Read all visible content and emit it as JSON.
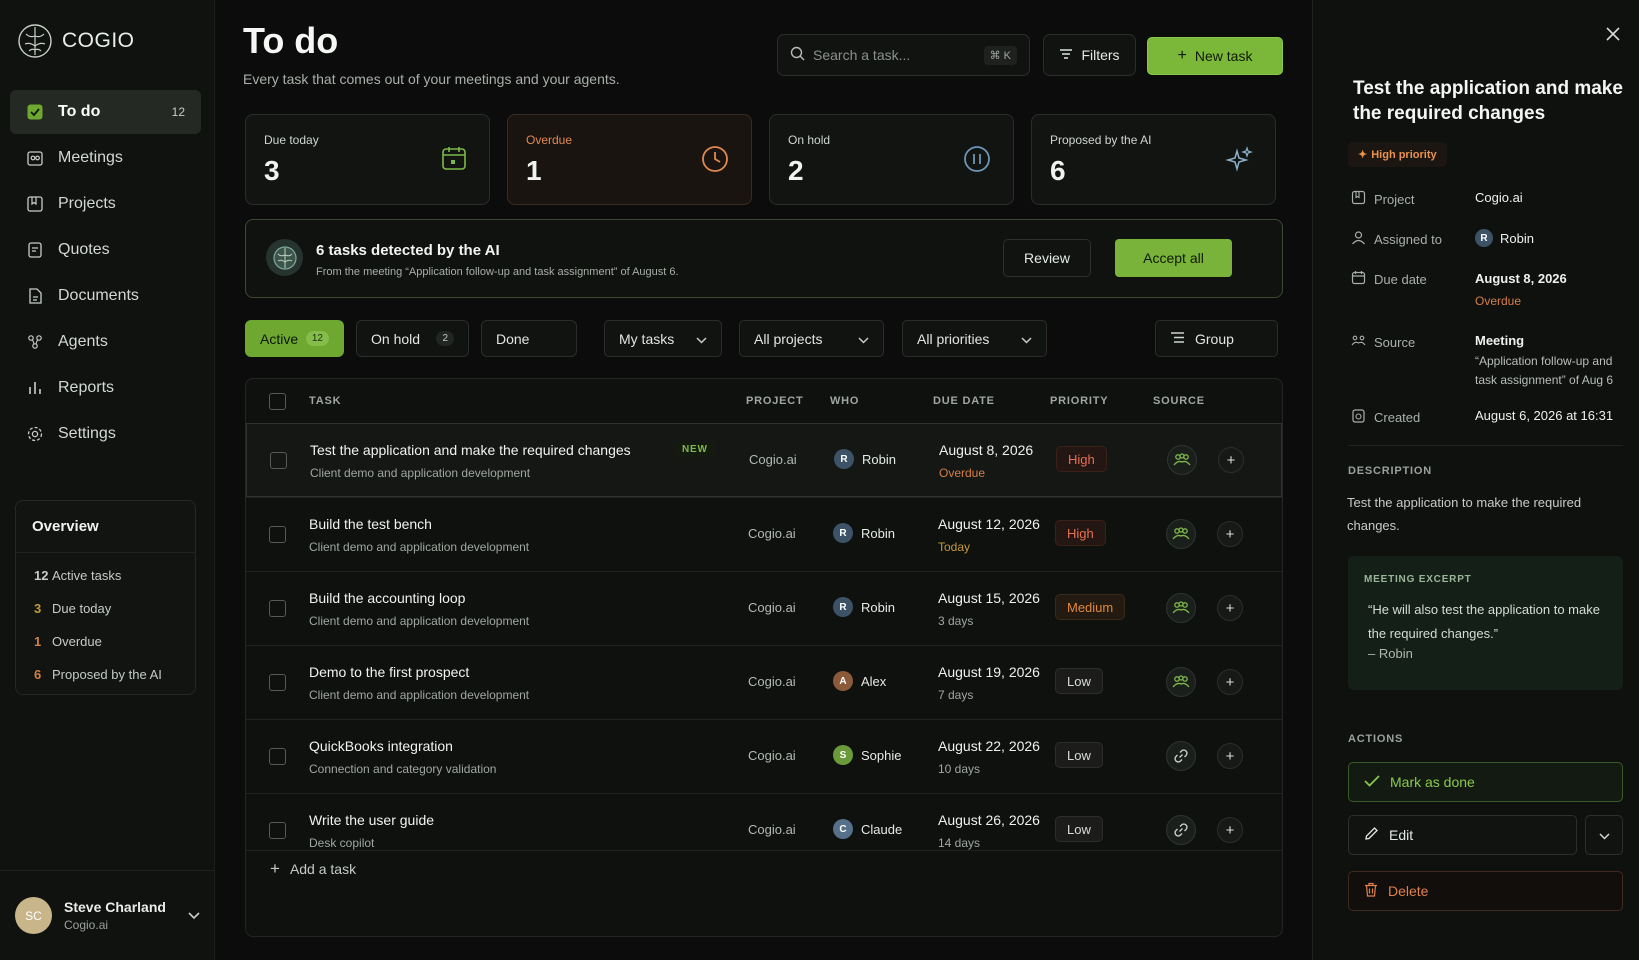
{
  "brand": {
    "name": "COGIO"
  },
  "nav": [
    {
      "label": "To do",
      "count": "12",
      "icon": "todo-icon",
      "active": true
    },
    {
      "label": "Meetings",
      "icon": "meetings-icon"
    },
    {
      "label": "Projects",
      "icon": "projects-icon"
    },
    {
      "label": "Quotes",
      "icon": "quotes-icon"
    },
    {
      "label": "Documents",
      "icon": "documents-icon"
    },
    {
      "label": "Agents",
      "icon": "agents-icon"
    },
    {
      "label": "Reports",
      "icon": "reports-icon"
    },
    {
      "label": "Settings",
      "icon": "settings-icon"
    }
  ],
  "overview": {
    "title": "Overview",
    "rows": [
      {
        "n": "12",
        "label": "Active tasks",
        "color": "#c6cbc6"
      },
      {
        "n": "3",
        "label": "Due today",
        "color": "#c29a3a"
      },
      {
        "n": "1",
        "label": "Overdue",
        "color": "#d47f45"
      },
      {
        "n": "6",
        "label": "Proposed by the AI",
        "color": "#d47f45"
      }
    ]
  },
  "user": {
    "initials": "SC",
    "name": "Steve Charland",
    "company": "Cogio.ai"
  },
  "header": {
    "title": "To do",
    "subtitle": "Every task that comes out of your meetings and your agents.",
    "search_placeholder": "Search a task...",
    "search_shortcut": "⌘ K",
    "filters_label": "Filters",
    "new_task_label": "New task"
  },
  "stats": [
    {
      "label": "Due today",
      "value": "3",
      "icon": "calendar-icon"
    },
    {
      "label": "Overdue",
      "value": "1",
      "icon": "clock-icon"
    },
    {
      "label": "On hold",
      "value": "2",
      "icon": "pause-icon"
    },
    {
      "label": "Proposed by the AI",
      "value": "6",
      "icon": "sparkle-icon"
    }
  ],
  "ai_banner": {
    "title": "6 tasks detected by the AI",
    "subtitle": "From the meeting “Application follow-up and task assignment” of August 6.",
    "review_label": "Review",
    "accept_label": "Accept all"
  },
  "tabs": [
    {
      "label": "Active",
      "count": "12"
    },
    {
      "label": "On hold",
      "count": "2"
    },
    {
      "label": "Done"
    }
  ],
  "dropdowns": {
    "tasks": "My tasks",
    "projects": "All projects",
    "priorities": "All priorities",
    "group": "Group"
  },
  "table": {
    "columns": [
      "TASK",
      "PROJECT",
      "WHO",
      "DUE DATE",
      "PRIORITY",
      "SOURCE"
    ],
    "rows": [
      {
        "title": "Test the application and make the required changes",
        "sub": "Client demo and application development",
        "badge": "NEW",
        "project": "Cogio.ai",
        "who": "Robin",
        "who_init": "R",
        "who_color": "#3c5266",
        "due": "August 8, 2026",
        "due_sub": "Overdue",
        "priority": "High",
        "source": "meeting-icon"
      },
      {
        "title": "Build the test bench",
        "sub": "Client demo and application development",
        "project": "Cogio.ai",
        "who": "Robin",
        "who_init": "R",
        "who_color": "#3c5266",
        "due": "August 12, 2026",
        "due_sub": "Today",
        "priority": "High",
        "source": "meeting-icon"
      },
      {
        "title": "Build the accounting loop",
        "sub": "Client demo and application development",
        "project": "Cogio.ai",
        "who": "Robin",
        "who_init": "R",
        "who_color": "#3c5266",
        "due": "August 15, 2026",
        "due_sub": "3 days",
        "priority": "Medium",
        "source": "meeting-icon"
      },
      {
        "title": "Demo to the first prospect",
        "sub": "Client demo and application development",
        "project": "Cogio.ai",
        "who": "Alex",
        "who_init": "A",
        "who_color": "#8a5a3a",
        "due": "August 19, 2026",
        "due_sub": "7 days",
        "priority": "Low",
        "source": "meeting-icon"
      },
      {
        "title": "QuickBooks integration",
        "sub": "Connection and category validation",
        "project": "Cogio.ai",
        "who": "Sophie",
        "who_init": "S",
        "who_color": "#6a9a3a",
        "due": "August 22, 2026",
        "due_sub": "10 days",
        "priority": "Low",
        "source": "link-icon"
      },
      {
        "title": "Write the user guide",
        "sub": "Desk copilot",
        "project": "Cogio.ai",
        "who": "Claude",
        "who_init": "C",
        "who_color": "#56708a",
        "due": "August 26, 2026",
        "due_sub": "14 days",
        "priority": "Low",
        "source": "link-icon"
      }
    ],
    "add_label": "Add a task"
  },
  "panel": {
    "title": "Test the application and make the required changes",
    "priority": "High priority",
    "project_label": "Project",
    "project": "Cogio.ai",
    "assigned_label": "Assigned to",
    "assigned": "Robin",
    "assigned_init": "R",
    "due_label": "Due date",
    "due": "August 8, 2026",
    "due_sub": "Overdue",
    "source_label": "Source",
    "source": "Meeting",
    "source_sub": "“Application follow-up and task assignment” of Aug 6",
    "created_label": "Created",
    "created": "August 6, 2026 at 16:31",
    "description_title": "DESCRIPTION",
    "description": "Test the application to make the required changes.",
    "excerpt_title": "MEETING EXCERPT",
    "excerpt": "“He will also test the application to make the required changes.”",
    "excerpt_author": "– Robin",
    "actions_title": "ACTIONS",
    "mark_done": "Mark as done",
    "edit": "Edit",
    "delete": "Delete"
  },
  "colors": {
    "accent": "#7bb83a",
    "overdue": "#d47f45",
    "high": "#e57052",
    "medium": "#e0873a"
  }
}
